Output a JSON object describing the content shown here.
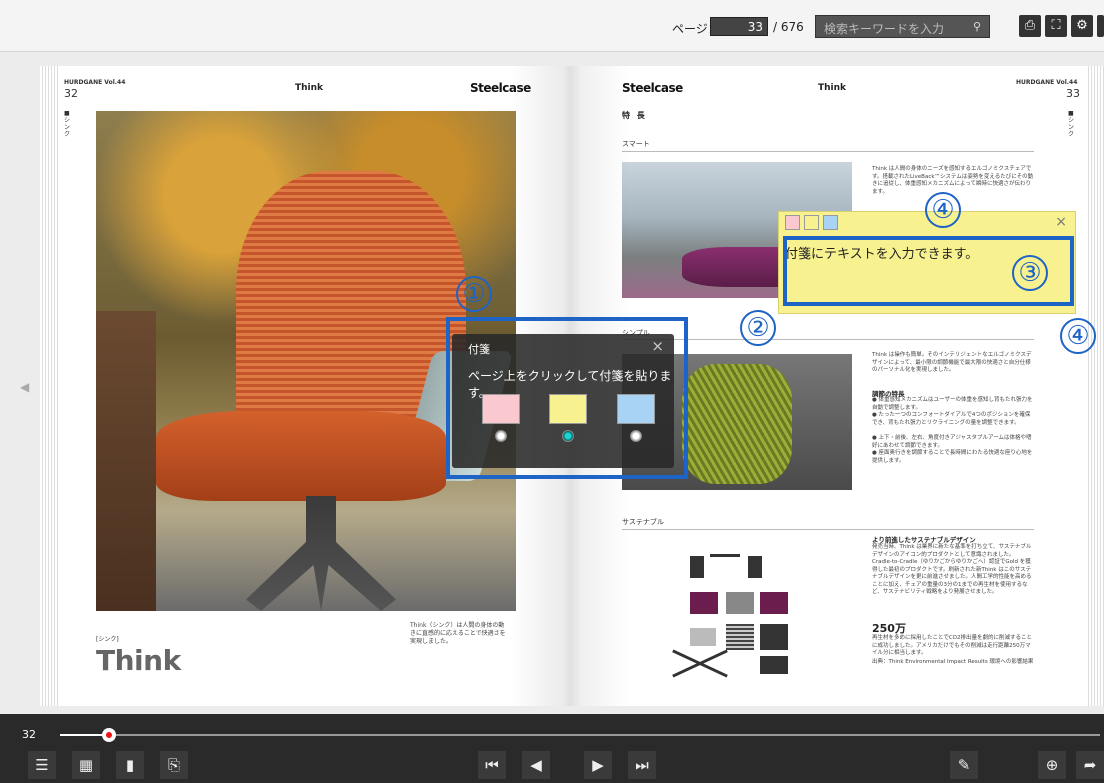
{
  "toolbar": {
    "page_label": "ページ：",
    "current_page": "33",
    "total_pages": "/ 676",
    "search_placeholder": "検索キーワードを入力",
    "search_icon": "search-icon",
    "buttons": [
      "print-icon",
      "fullscreen-icon",
      "gear-icon"
    ]
  },
  "left_page": {
    "magazine": "HURDGANE Vol.44",
    "page_number": "32",
    "header_title": "Think",
    "brand": "Steelcase",
    "vertical_label": "■シンク",
    "caption_small": "[シンク]",
    "caption_big": "Think",
    "description": "Think（シンク）は人間の身体の動きに直感的に応えることで快適さを実現しました。"
  },
  "right_page": {
    "brand": "Steelcase",
    "header_title": "Think",
    "magazine": "HURDGANE Vol.44",
    "page_number": "33",
    "vertical_label": "■シンク",
    "feature_title": "特 長",
    "section_smart": "スマート",
    "section_simple": "シンプル",
    "section_sustainable": "サステナブル",
    "smart_text": "Think は人間の身体のニーズを感知するエルゴノミクスチェアです。搭載されたLiveBack™システムは姿勢を変えるたびにその動きに追従し、体重感知メカニズムによって瞬時に快適さが伝わります。",
    "simple_text": "Think は操作も簡単。そのインテリジェントなエルゴノミクスデザインによって、最小限の調節機能で最大限の快適さと自分仕様のパーソナル化を実現しました。",
    "adjust_heading": "調節の特長",
    "adjust_items": [
      "● 体重感知メカニズムはユーザーの体重を感知し背もたれ張力を自動で調整します。",
      "● たった一つのコンフォートダイアルで4つのポジションを確保でき、背もたれ張力とリクライニングの量を調整できます。",
      "● 上下・前後、左右、角度付きアジャスタブルアームは体格や嗜好にあわせて調節できます。",
      "● 座面奥行きを調節することで長時間にわたる快適な座り心地を提供します。"
    ],
    "sustain_heading": "より前進したサステナブルデザイン",
    "sustain_text": "発売当時、Think は業界に新たな基準を打ち立て、サステナブルデザインのアイコン的プロダクトとして意識されました。Cradle-to-Cradle（ゆりかごからゆりかごへ）認証でGold を獲得した最初のプロダクトです。刷新された新Think はこのサステナブルデザインを更に前進させました。人間工学的性能を高めることに加え、チェアの重量の3分の1までの再生材を使用するなど、サステナビリティ戦略をより発展させました。",
    "big_number": "250万",
    "number_text": "再生材を多めに採用したことでCO2排出量を劇的に削減することに成功しました。アメリカだけでもその削減は走行距離250万マイル分に相当します。",
    "source": "出典：Think Environmental Impact Results 環境への影響結果"
  },
  "note_popup": {
    "title": "付箋",
    "close": "×",
    "message": "ページ上をクリックして付箋を貼ります。",
    "colors": [
      "#f9c9cf",
      "#f7f18f",
      "#a9d3f5"
    ],
    "selected_index": 1
  },
  "yellow_note": {
    "text": "付箋にテキストを入力できます。",
    "close": "×",
    "colors": [
      "#f9c9cf",
      "#f7f18f",
      "#a9d3f5"
    ]
  },
  "callouts": {
    "c1": "①",
    "c2": "②",
    "c3": "③",
    "c4a": "④",
    "c4b": "④"
  },
  "accent_color": "#1e63c6",
  "bottom": {
    "slider_page": "32",
    "slider_fraction": 0.047,
    "left_buttons": [
      "toc-icon",
      "thumbnail-grid-icon",
      "single-page-icon",
      "sticky-note-icon"
    ],
    "nav_buttons": [
      "first-page-icon",
      "prev-page-icon",
      "next-page-icon",
      "last-page-icon"
    ],
    "right_buttons": [
      "eraser-icon",
      "zoom-in-icon",
      "share-icon"
    ]
  }
}
